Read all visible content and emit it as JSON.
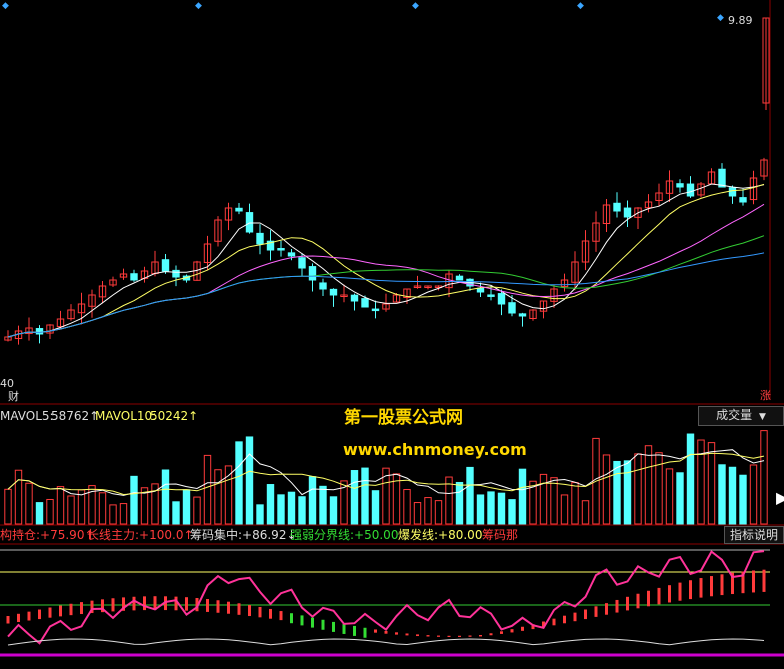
{
  "colors": {
    "up": "#ff3b3b",
    "down": "#54ffff",
    "ma5": "#ffffff",
    "ma10": "#ffff66",
    "ma20": "#ff66ff",
    "ma30": "#33cc33",
    "ma60": "#3399ff",
    "grid": "#8b0000"
  },
  "price_panel": {
    "top_value": "9.89",
    "bottom_value": "40",
    "finance_tag": "财",
    "rise_tag": "涨"
  },
  "volume_panel": {
    "mavol5_label": "MAVOL5:",
    "mavol5_value": "58762↑",
    "mavol10_label": "MAVOL10:",
    "mavol10_value": "50242↑",
    "dropdown": "成交量"
  },
  "indicator_panel": {
    "i1_label": "构持仓:",
    "i1_value": "+75.90↑",
    "i2_label": "长线主力:",
    "i2_value": "+100.0↑",
    "i3_label": "筹码集中:",
    "i3_value": "+86.92↓",
    "i4_label": "强弱分界线:",
    "i4_value": "+50.00",
    "i5_label": "爆发线:",
    "i5_value": "+80.00",
    "i6_label": "筹码那",
    "button": "指标说明"
  },
  "watermark": {
    "title": "第一股票公式网",
    "url": "www.chnmoney.com"
  },
  "chart_data": [
    {
      "type": "candlestick",
      "panel": "price",
      "ylabel_top": "9.89",
      "ylabel_bottom": "40",
      "close": [
        41,
        43,
        44,
        42,
        45,
        47,
        50,
        52,
        55,
        58,
        60,
        62,
        60,
        63,
        66,
        63,
        61,
        60,
        66,
        72,
        80,
        84,
        83,
        76,
        72,
        70,
        70,
        68,
        64,
        60,
        57,
        55,
        55,
        53,
        51,
        50,
        52,
        55,
        57,
        58,
        58,
        58,
        62,
        60,
        58,
        56,
        55,
        52,
        49,
        48,
        50,
        53,
        57,
        60,
        66,
        73,
        79,
        85,
        83,
        81,
        84,
        86,
        89,
        93,
        91,
        88,
        92,
        96,
        91,
        88,
        86,
        94,
        100
      ],
      "series": [
        {
          "name": "MA5"
        },
        {
          "name": "MA10"
        },
        {
          "name": "MA20"
        },
        {
          "name": "MA30"
        },
        {
          "name": "MA60"
        }
      ]
    },
    {
      "type": "bar",
      "panel": "volume",
      "series": [
        {
          "name": "MAVOL5",
          "values": [
            58762
          ]
        },
        {
          "name": "MAVOL10",
          "values": [
            50242
          ]
        }
      ]
    },
    {
      "type": "line",
      "panel": "indicator",
      "series": [
        {
          "name": "构持仓",
          "values": [
            75.9
          ]
        },
        {
          "name": "长线主力",
          "values": [
            100.0
          ]
        },
        {
          "name": "筹码集中",
          "values": [
            86.92
          ]
        },
        {
          "name": "强弱分界线",
          "values": [
            50.0
          ]
        },
        {
          "name": "爆发线",
          "values": [
            80.0
          ]
        }
      ]
    }
  ]
}
